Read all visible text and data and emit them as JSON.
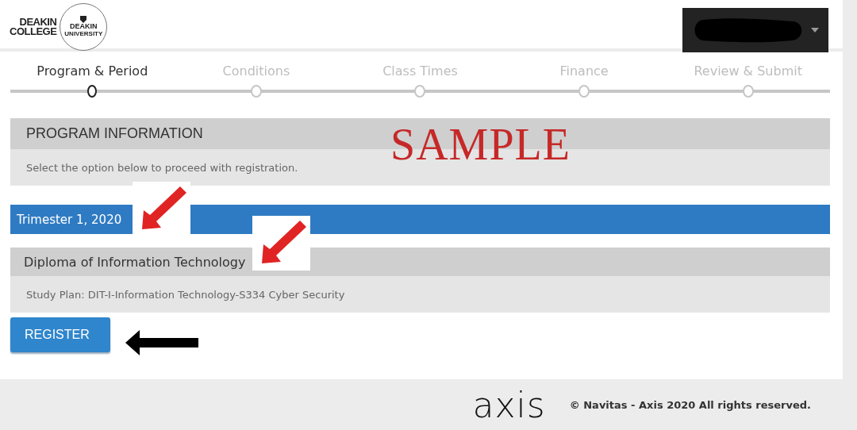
{
  "header": {
    "logo": {
      "line_1": "DEAKIN",
      "line_2": "COLLEGE",
      "badge_line_1": "DEAKIN",
      "badge_line_2": "UNIVERSITY"
    },
    "user_menu": {
      "expanded": false
    }
  },
  "steps": [
    {
      "label": "Program & Period",
      "selected": true
    },
    {
      "label": "Conditions",
      "selected": false
    },
    {
      "label": "Class Times",
      "selected": false
    },
    {
      "label": "Finance",
      "selected": false
    },
    {
      "label": "Review & Submit",
      "selected": false
    }
  ],
  "program_information": {
    "title": "PROGRAM INFORMATION",
    "description": "Select the option below to proceed with registration."
  },
  "period": {
    "title": "Trimester 1, 2020"
  },
  "program": {
    "title": "Diploma of Information Technology",
    "study_plan": "Study Plan: DIT-I-Information Technology-S334 Cyber Security"
  },
  "register_button": "REGISTER",
  "annotations": [
    {
      "kind": "stamp",
      "text": "SAMPLE"
    },
    {
      "kind": "red-arrow"
    },
    {
      "kind": "red-arrow"
    },
    {
      "kind": "black-arrow"
    }
  ],
  "footer": {
    "logo": "axis",
    "copyright": "© Navitas - Axis 2020 All rights reserved."
  }
}
